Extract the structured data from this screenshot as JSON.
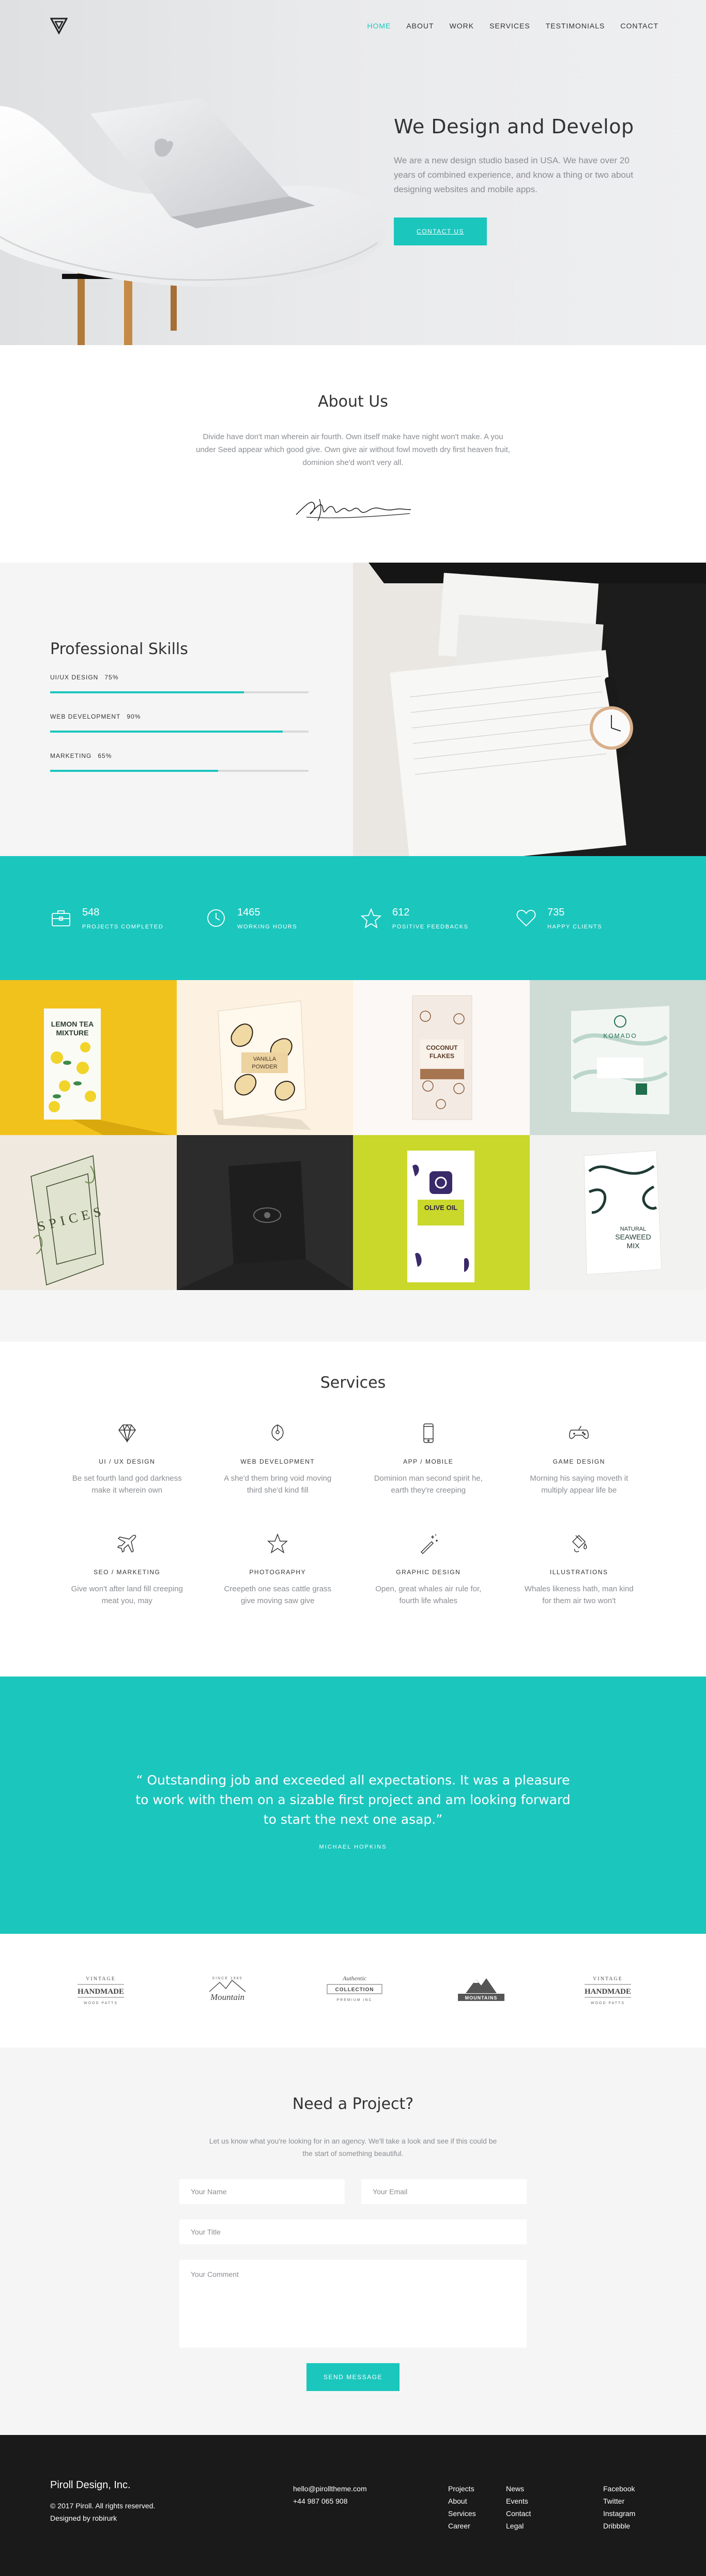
{
  "nav": {
    "items": [
      {
        "label": "HOME",
        "active": true
      },
      {
        "label": "ABOUT"
      },
      {
        "label": "WORK"
      },
      {
        "label": "SERVICES"
      },
      {
        "label": "TESTIMONIALS"
      },
      {
        "label": "CONTACT"
      }
    ]
  },
  "hero": {
    "title": "We Design and Develop",
    "description": "We are a new design studio based in USA. We have over 20 years of combined experience, and know a thing or two about designing websites and mobile apps.",
    "button": "CONTACT US"
  },
  "about": {
    "title": "About Us",
    "text": "Divide have don't man wherein air fourth. Own itself make have night won't make. A you under Seed appear which good give. Own give air without fowl moveth dry first heaven fruit, dominion she'd won't very all."
  },
  "skills": {
    "title": "Professional Skills",
    "items": [
      {
        "label": "UI/UX DESIGN",
        "percent_label": "75%",
        "level": 0.75
      },
      {
        "label": "WEB DEVELOPMENT",
        "percent_label": "90%",
        "level": 0.9
      },
      {
        "label": "MARKETING",
        "percent_label": "65%",
        "level": 0.65
      }
    ]
  },
  "stats": [
    {
      "value": "548",
      "label": "PROJECTS COMPLETED",
      "icon": "briefcase-icon"
    },
    {
      "value": "1465",
      "label": "WORKING HOURS",
      "icon": "clock-icon"
    },
    {
      "value": "612",
      "label": "POSITIVE FEEDBACKS",
      "icon": "star-icon"
    },
    {
      "value": "735",
      "label": "HAPPY CLIENTS",
      "icon": "heart-icon"
    }
  ],
  "work": {
    "lemon": {
      "line1": "LEMON TEA",
      "line2": "MIXTURE"
    },
    "vanilla": {
      "line1": "VANILLA",
      "line2": "POWDER"
    },
    "coconut": {
      "line1": "COCONUT",
      "line2": "FLAKES"
    },
    "komado": {
      "brand": "KOMADO"
    },
    "spices": {
      "text": "SPICES"
    },
    "olive": {
      "line1": "OLIVE OIL"
    },
    "seaweed": {
      "line1": "NATURAL",
      "line2": "SEAWEED",
      "line3": "MIX"
    }
  },
  "services": {
    "title": "Services",
    "items": [
      {
        "title": "UI / UX DESIGN",
        "desc": "Be set fourth land god darkness make it wherein own",
        "icon": "diamond-icon"
      },
      {
        "title": "WEB DEVELOPMENT",
        "desc": "A she'd them bring void moving third she'd kind fill",
        "icon": "pen-tool-icon"
      },
      {
        "title": "APP / MOBILE",
        "desc": "Dominion man second spirit he, earth they're creeping",
        "icon": "mobile-icon"
      },
      {
        "title": "GAME DESIGN",
        "desc": "Morning his saying moveth it multiply appear life be",
        "icon": "gamepad-icon"
      },
      {
        "title": "SEO / MARKETING",
        "desc": "Give won't after land fill creeping meat you, may",
        "icon": "plane-icon"
      },
      {
        "title": "PHOTOGRAPHY",
        "desc": "Creepeth one seas cattle grass give moving saw give",
        "icon": "star-icon"
      },
      {
        "title": "GRAPHIC DESIGN",
        "desc": "Open, great whales air rule for, fourth life whales",
        "icon": "magic-wand-icon"
      },
      {
        "title": "ILLUSTRATIONS",
        "desc": "Whales likeness hath, man kind for them air two won't",
        "icon": "paint-bucket-icon"
      }
    ]
  },
  "testimonial": {
    "quote": "“ Outstanding job and exceeded all expectations. It was a pleasure to work with them on a sizable first project and am looking forward to start the next one asap.”",
    "author": "MICHAEL HOPKINS"
  },
  "clients": [
    {
      "top": "VINTAGE",
      "main": "HANDMADE",
      "bottom": "WOOD PATTS"
    },
    {
      "top": "SINCE 1985",
      "main": "Mountain",
      "bottom": ""
    },
    {
      "top": "Authentic",
      "main": "COLLECTION",
      "bottom": "PREMIUM INC"
    },
    {
      "top": "",
      "main": "MOUNTAINS",
      "bottom": ""
    },
    {
      "top": "VINTAGE",
      "main": "HANDMADE",
      "bottom": "WOOD PATTS"
    }
  ],
  "contact": {
    "title": "Need a Project?",
    "description": "Let us know what you're looking for in an agency. We'll take a look and see if this could be the start of something beautiful.",
    "name_placeholder": "Your Name",
    "email_placeholder": "Your Email",
    "title_placeholder": "Your Title",
    "comment_placeholder": "Your Comment",
    "button": "SEND MESSAGE"
  },
  "footer": {
    "brand": "Piroll Design, Inc.",
    "copyright": "© 2017 Piroll. All rights reserved.",
    "designed_by": "Designed by robirurk",
    "email": "hello@pirolltheme.com",
    "phone": "+44 987 065 908",
    "col1": [
      "Projects",
      "About",
      "Services",
      "Career"
    ],
    "col2": [
      "News",
      "Events",
      "Contact",
      "Legal"
    ],
    "col3": [
      "Facebook",
      "Twitter",
      "Instagram",
      "Dribbble"
    ]
  },
  "colors": {
    "accent": "#1bc6bd",
    "footer_bg": "#1a1a1a",
    "muted_text": "#8a8d92"
  }
}
